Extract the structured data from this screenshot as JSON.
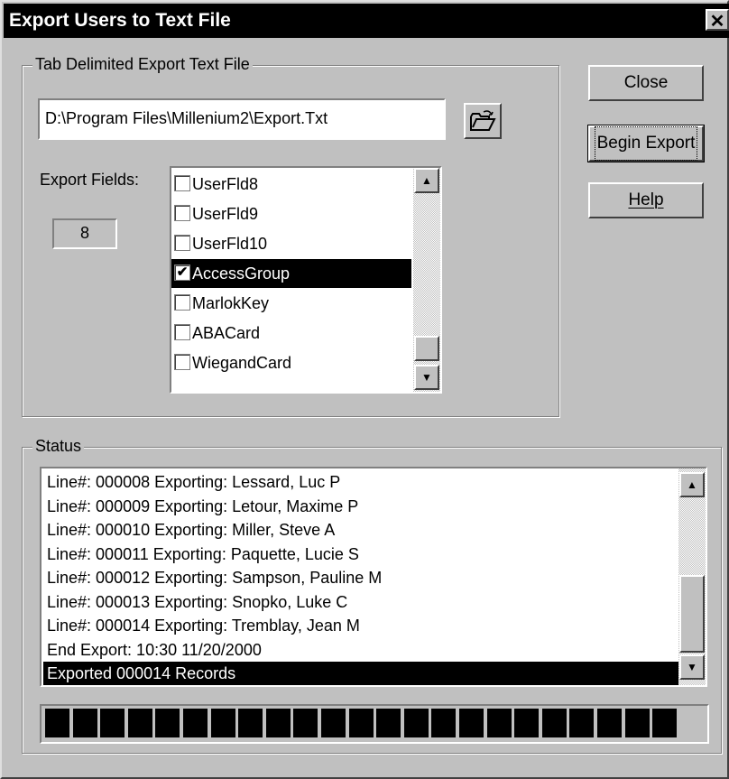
{
  "window": {
    "title": "Export Users to Text File",
    "close_glyph": "✕"
  },
  "export_group": {
    "label": "Tab Delimited Export Text File",
    "file_path": "D:\\Program Files\\Millenium2\\Export.Txt",
    "browse_icon": "open-folder-icon",
    "fields_label": "Export Fields:",
    "fields_count": "8",
    "fields": [
      {
        "name": "UserFld8",
        "checked": false,
        "selected": false
      },
      {
        "name": "UserFld9",
        "checked": false,
        "selected": false
      },
      {
        "name": "UserFld10",
        "checked": false,
        "selected": false
      },
      {
        "name": "AccessGroup",
        "checked": true,
        "selected": true
      },
      {
        "name": "MarlokKey",
        "checked": false,
        "selected": false
      },
      {
        "name": "ABACard",
        "checked": false,
        "selected": false
      },
      {
        "name": "WiegandCard",
        "checked": false,
        "selected": false
      }
    ]
  },
  "buttons": {
    "close": "Close",
    "begin_export": "Begin Export",
    "help": "Help"
  },
  "status_group": {
    "label": "Status",
    "lines": [
      "Line#: 000008 Exporting: Lessard, Luc P",
      "Line#: 000009 Exporting: Letour, Maxime P",
      "Line#: 000010 Exporting: Miller, Steve  A",
      "Line#: 000011 Exporting: Paquette, Lucie S",
      "Line#: 000012 Exporting: Sampson, Pauline M",
      "Line#: 000013 Exporting: Snopko, Luke C",
      "Line#: 000014 Exporting: Tremblay, Jean M",
      "End Export: 10:30 11/20/2000",
      "Exported 000014 Records"
    ],
    "selected_line_index": 8,
    "progress_fraction": 1.0
  },
  "colors": {
    "selection_bg": "#000000",
    "selection_fg": "#ffffff",
    "face": "#c0c0c0"
  }
}
